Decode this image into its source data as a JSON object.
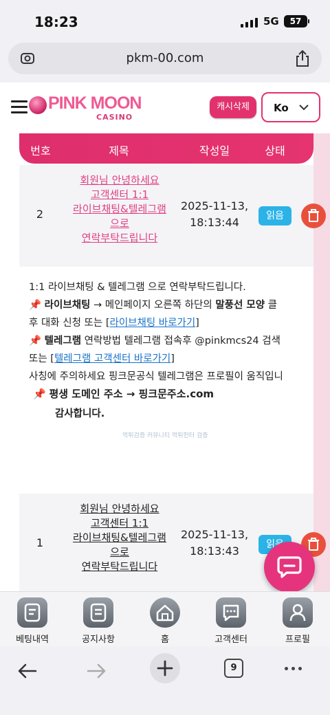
{
  "status_bar": {
    "time": "18:23",
    "network": "5G",
    "battery": "57"
  },
  "browser": {
    "url": "pkm-00.com",
    "tabs_count": "9"
  },
  "header": {
    "logo_text": "PINK MOON",
    "logo_sub": "CASINO",
    "cache_button": "캐시삭제",
    "language": "Ko"
  },
  "table": {
    "columns": [
      "번호",
      "제목",
      "작성일",
      "상태"
    ],
    "rows": [
      {
        "number": "2",
        "title_lines": [
          "회원님 안녕하세요",
          "고객센터 1:1",
          "라이브채팅&텔레그램",
          "으로",
          "연락부탁드립니다"
        ],
        "date": "2025-11-13,",
        "time": "18:13:44",
        "status": "읽음"
      },
      {
        "number": "1",
        "title_lines": [
          "회원님 안녕하세요",
          "고객센터 1:1",
          "라이브채팅&텔레그램",
          "으로",
          "연락부탁드립니다"
        ],
        "date": "2025-11-13,",
        "time": "18:13:43",
        "status": "읽음"
      }
    ]
  },
  "detail": {
    "line1": "1:1 라이브채팅 & 텔레그램 으로 연락부탁드립니다.",
    "line2_bold": "라이브채팅",
    "line2_mid": " → 메인페이지 오른쪽 하단의 ",
    "line2_bold2": "말풍선 모양",
    "line2_end": " 클",
    "line3_pre": "후 대화 신청 또는 [",
    "line3_link": "라이브채팅 바로가기",
    "line3_post": "]",
    "line4_bold": "텔레그램",
    "line4_rest": " 연락방법 텔레그램 접속후 @pinkmcs24 검색",
    "line5_pre": "또는 [",
    "line5_link": "텔레그램 고객센터 바로가기",
    "line5_post": "]",
    "line6": "사칭에 주의하세요 핑크문공식 텔레그램은 프로필이 움직입니",
    "line7": "평생 도메인 주소 → 핑크문주소.com",
    "line8": "감사합니다.",
    "watermark": "먹튀검증 커뮤니티 먹튀헌터 검증"
  },
  "bottom_nav": {
    "items": [
      {
        "label": "베팅내역",
        "icon": "betting-history-icon"
      },
      {
        "label": "공지사항",
        "icon": "notice-icon"
      },
      {
        "label": "홈",
        "icon": "home-icon"
      },
      {
        "label": "고객센터",
        "icon": "customer-center-icon"
      },
      {
        "label": "프로필",
        "icon": "profile-icon"
      }
    ]
  },
  "colors": {
    "accent": "#e2326d",
    "link": "#1a73c9",
    "badge": "#2bb3e8",
    "delete": "#e9503c"
  }
}
